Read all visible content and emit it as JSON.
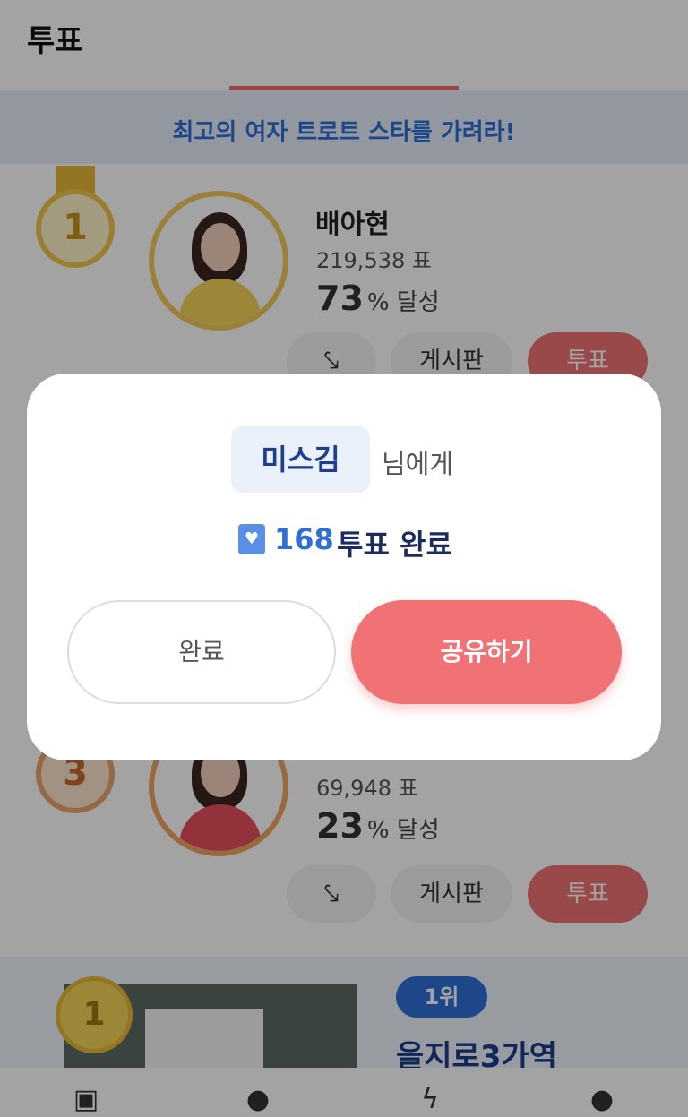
{
  "header": {
    "title": "투표"
  },
  "banner": {
    "text": "최고의 여자 트로트 스타를 가려라!"
  },
  "rankings": [
    {
      "rank": "1",
      "name": "배아현",
      "votes": "219,538 표",
      "percent": "73",
      "percent_suffix": "% 달성"
    },
    {
      "rank": "3",
      "votes": "69,948 표",
      "percent": "23",
      "percent_suffix": "% 달성"
    }
  ],
  "card_actions": {
    "share_icon": "share-icon",
    "board_label": "게시판",
    "vote_label": "투표"
  },
  "promo": {
    "medal": "1",
    "rank_badge": "1위",
    "place": "을지로3가역"
  },
  "bottom_nav": [
    {
      "icon": "heart-box-icon"
    },
    {
      "icon": "chat-icon"
    },
    {
      "icon": "lightning-icon"
    },
    {
      "icon": "person-icon"
    }
  ],
  "modal": {
    "recipient": "미스김",
    "recipient_suffix": "님에게",
    "vote_count": "168",
    "vote_done": "투표 완료",
    "done_button": "완료",
    "share_button": "공유하기"
  },
  "colors": {
    "accent": "#f07275",
    "blue": "#2f6fd6",
    "overlay": "rgba(0,0,0,0.36)"
  }
}
